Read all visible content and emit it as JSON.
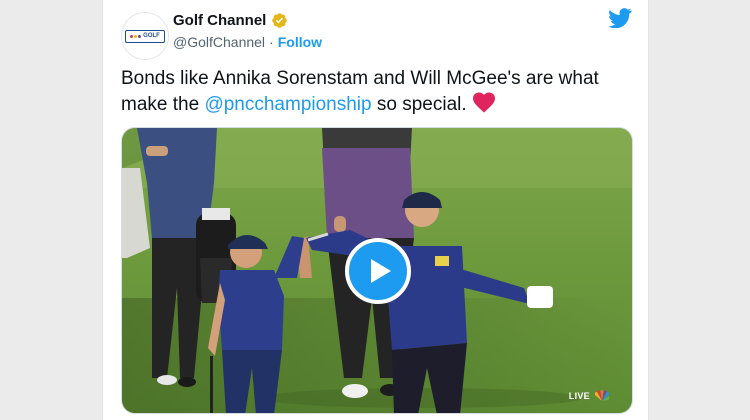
{
  "author": {
    "display_name": "Golf Channel",
    "handle": "@GolfChannel",
    "separator": "·",
    "follow_label": "Follow",
    "avatar_text": "GOLF"
  },
  "tweet": {
    "text_before": "Bonds like Annika Sorenstam and Will McGee's are what make the ",
    "mention": "@pncchampionship",
    "text_after": " so special. "
  },
  "video": {
    "live_label": "LIVE"
  },
  "icons": {
    "verified": "verified-badge-icon",
    "twitter": "twitter-bird-icon",
    "heart": "red-heart-icon",
    "play": "play-icon",
    "network": "nbc-peacock-icon"
  },
  "colors": {
    "accent": "#1d9bf0",
    "verified_gold": "#e2b719",
    "heart": "#e0245e",
    "text": "#0f1419",
    "muted": "#536471"
  }
}
